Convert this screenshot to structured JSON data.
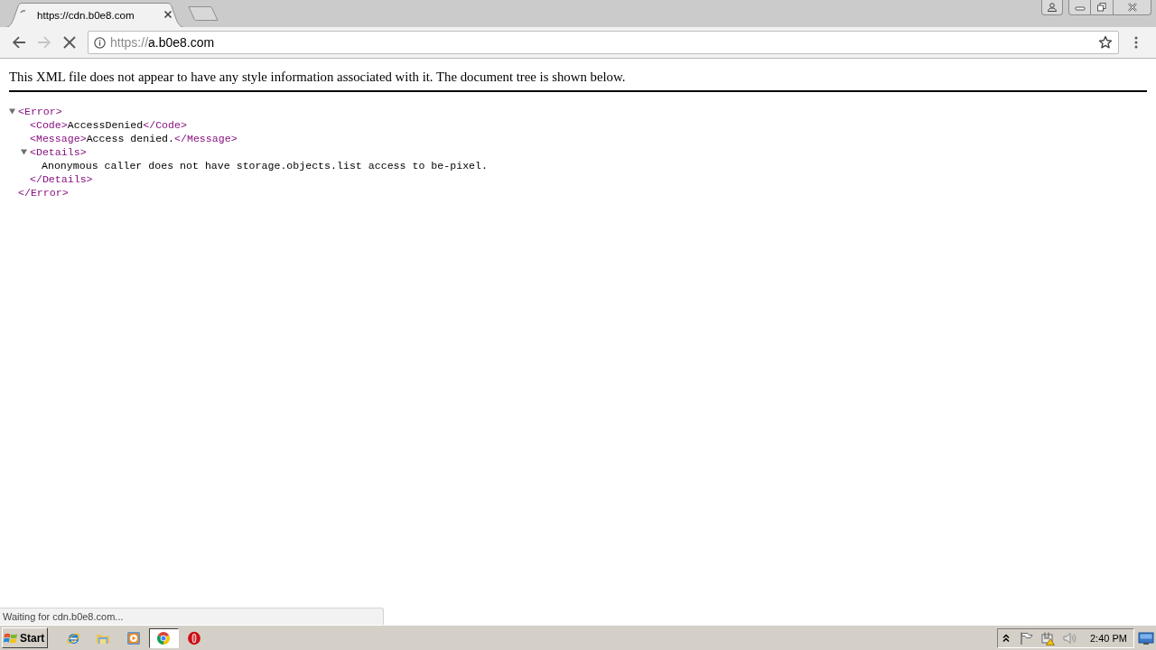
{
  "browser": {
    "tabs": [
      {
        "title": "https://cdn.b0e8.com",
        "selected": true
      }
    ],
    "navigation": [
      {
        "kind": "back",
        "disabled": false
      },
      {
        "kind": "forward",
        "disabled": true
      },
      {
        "kind": "stop",
        "disabled": false
      }
    ],
    "address_bar": {
      "scheme": "https://",
      "host": "a.b0e8.com"
    }
  },
  "page": {
    "notice": "This XML file does not appear to have any style information associated with it. The document tree is shown below.",
    "xml_tree": [
      {
        "kind": "element",
        "open_tag": "<Error>",
        "close_tag": "</Error>",
        "expanded": true,
        "children": [
          {
            "kind": "leaf",
            "open_tag": "<Code>",
            "text": "AccessDenied",
            "close_tag": "</Code>"
          },
          {
            "kind": "leaf",
            "open_tag": "<Message>",
            "text": "Access denied.",
            "close_tag": "</Message>"
          },
          {
            "kind": "element",
            "open_tag": "<Details>",
            "close_tag": "</Details>",
            "expanded": true,
            "children": [
              {
                "kind": "text",
                "text": "Anonymous caller does not have storage.objects.list access to be-pixel."
              }
            ]
          }
        ]
      }
    ]
  },
  "status_bubble": {
    "text": "Waiting for cdn.b0e8.com..."
  },
  "taskbar": {
    "start_label": "Start",
    "apps": [
      {
        "kind": "ie",
        "selected": false
      },
      {
        "kind": "explorer",
        "selected": false
      },
      {
        "kind": "media",
        "selected": false
      },
      {
        "kind": "chrome",
        "selected": true
      },
      {
        "kind": "opera",
        "selected": false
      }
    ],
    "clock": "2:40 PM"
  }
}
